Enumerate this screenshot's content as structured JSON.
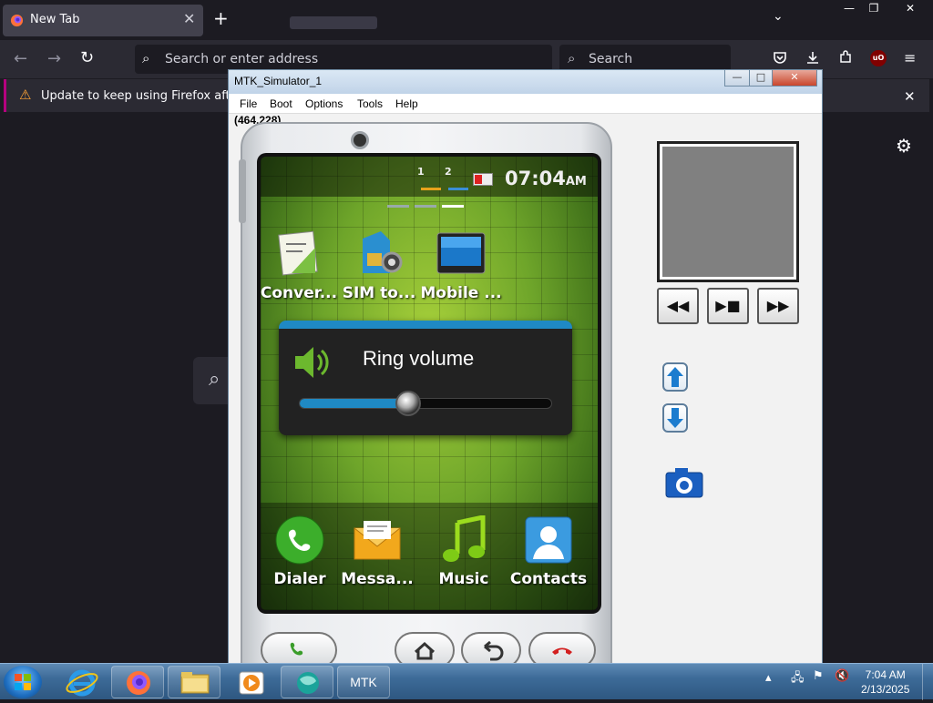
{
  "browser": {
    "tab_title": "New Tab",
    "tab_close": "✕",
    "new_tab": "+",
    "list_tabs": "⌄",
    "url_placeholder": "Search or enter address",
    "search_placeholder": "Search",
    "notification_text": "Update to keep using Firefox after March",
    "notification_close": "✕",
    "window_min": "—",
    "window_max": "❐",
    "window_close": "✕"
  },
  "simulator": {
    "title": "MTK_Simulator_1",
    "menu": [
      "File",
      "Boot",
      "Options",
      "Tools",
      "Help"
    ],
    "coord_readout": "(464,228)",
    "title_buttons": [
      "—",
      "□",
      "✕"
    ]
  },
  "phone": {
    "sim_labels": [
      "1",
      "2"
    ],
    "time": "07:04",
    "time_suffix": "AM",
    "apps": [
      "Conver...",
      "SIM to...",
      "Mobile ..."
    ],
    "volume": {
      "title": "Ring volume",
      "level": 0.43
    },
    "dock": [
      "Dialer",
      "Messa...",
      "Music",
      "Contacts"
    ]
  },
  "side_panel": {
    "media_buttons": [
      "◀◀",
      "▶■",
      "▶▶"
    ],
    "up_arrow": "▲",
    "down_arrow": "▼"
  },
  "taskbar": {
    "active_item": "MTK",
    "time": "7:04 AM",
    "date": "2/13/2025"
  },
  "colors": {
    "accent_blue": "#1f89c4",
    "notice_bar": "#b5007f",
    "screen_green": "#6ea52a"
  }
}
